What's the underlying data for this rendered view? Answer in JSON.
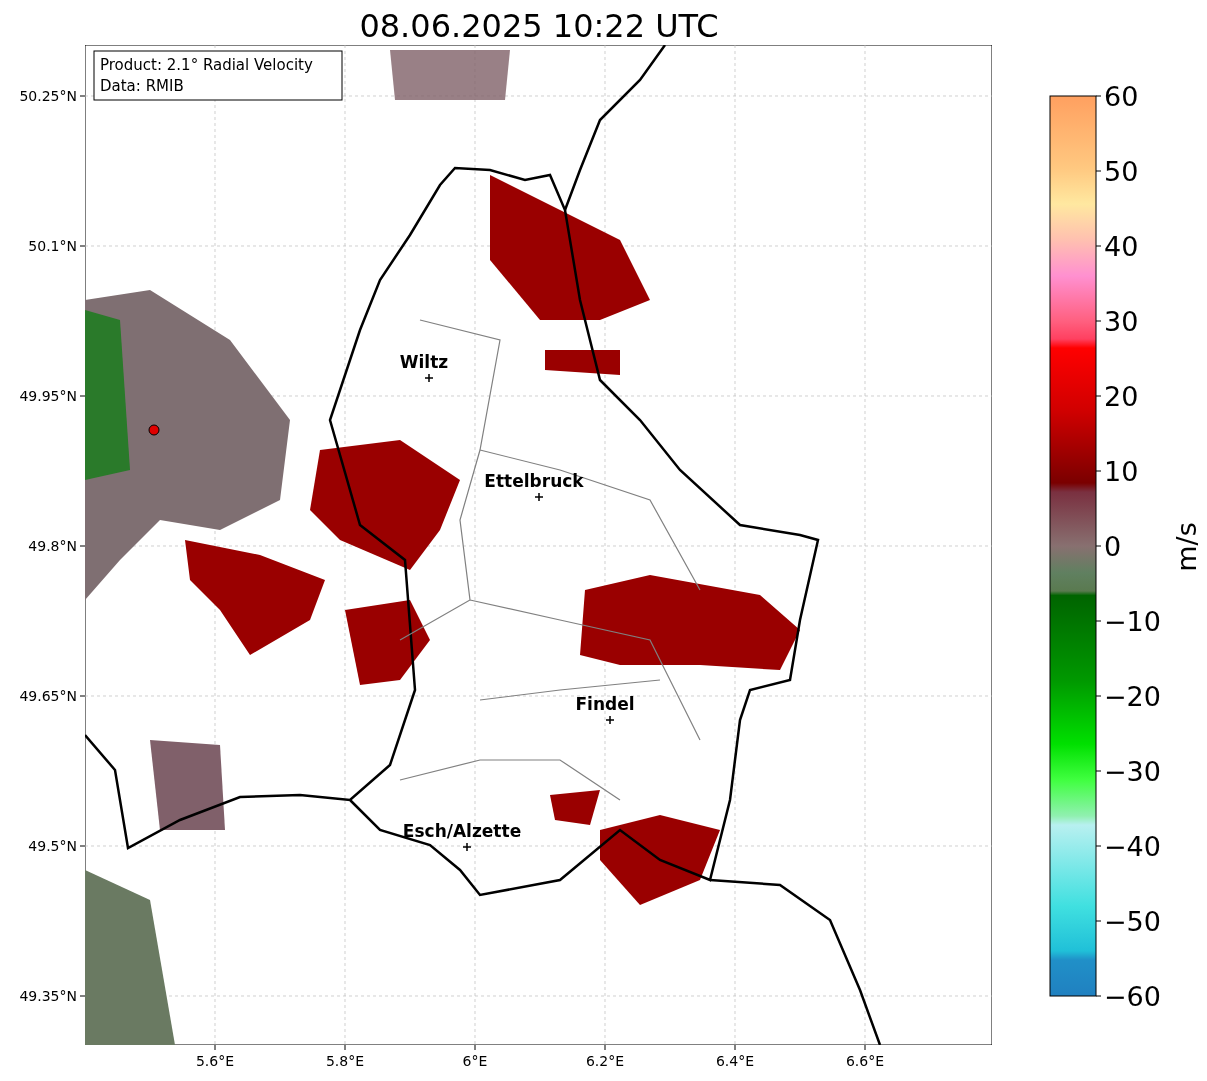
{
  "title": "08.06.2025 10:22 UTC",
  "info_box": [
    "Product: 2.1° Radial Velocity",
    "Data: RMIB"
  ],
  "y_ticks": [
    "50.25°N",
    "50.1°N",
    "49.95°N",
    "49.8°N",
    "49.65°N",
    "49.5°N",
    "49.35°N"
  ],
  "x_ticks": [
    "5.6°E",
    "5.8°E",
    "6°E",
    "6.2°E",
    "6.4°E",
    "6.6°E"
  ],
  "cities": [
    {
      "name": "Wiltz"
    },
    {
      "name": "Ettelbruck"
    },
    {
      "name": "Findel"
    },
    {
      "name": "Esch/Alzette"
    }
  ],
  "colorbar": {
    "label": "m/s",
    "ticks": [
      "60",
      "50",
      "40",
      "30",
      "20",
      "10",
      "0",
      "−10",
      "−20",
      "−30",
      "−40",
      "−50",
      "−60"
    ]
  }
}
